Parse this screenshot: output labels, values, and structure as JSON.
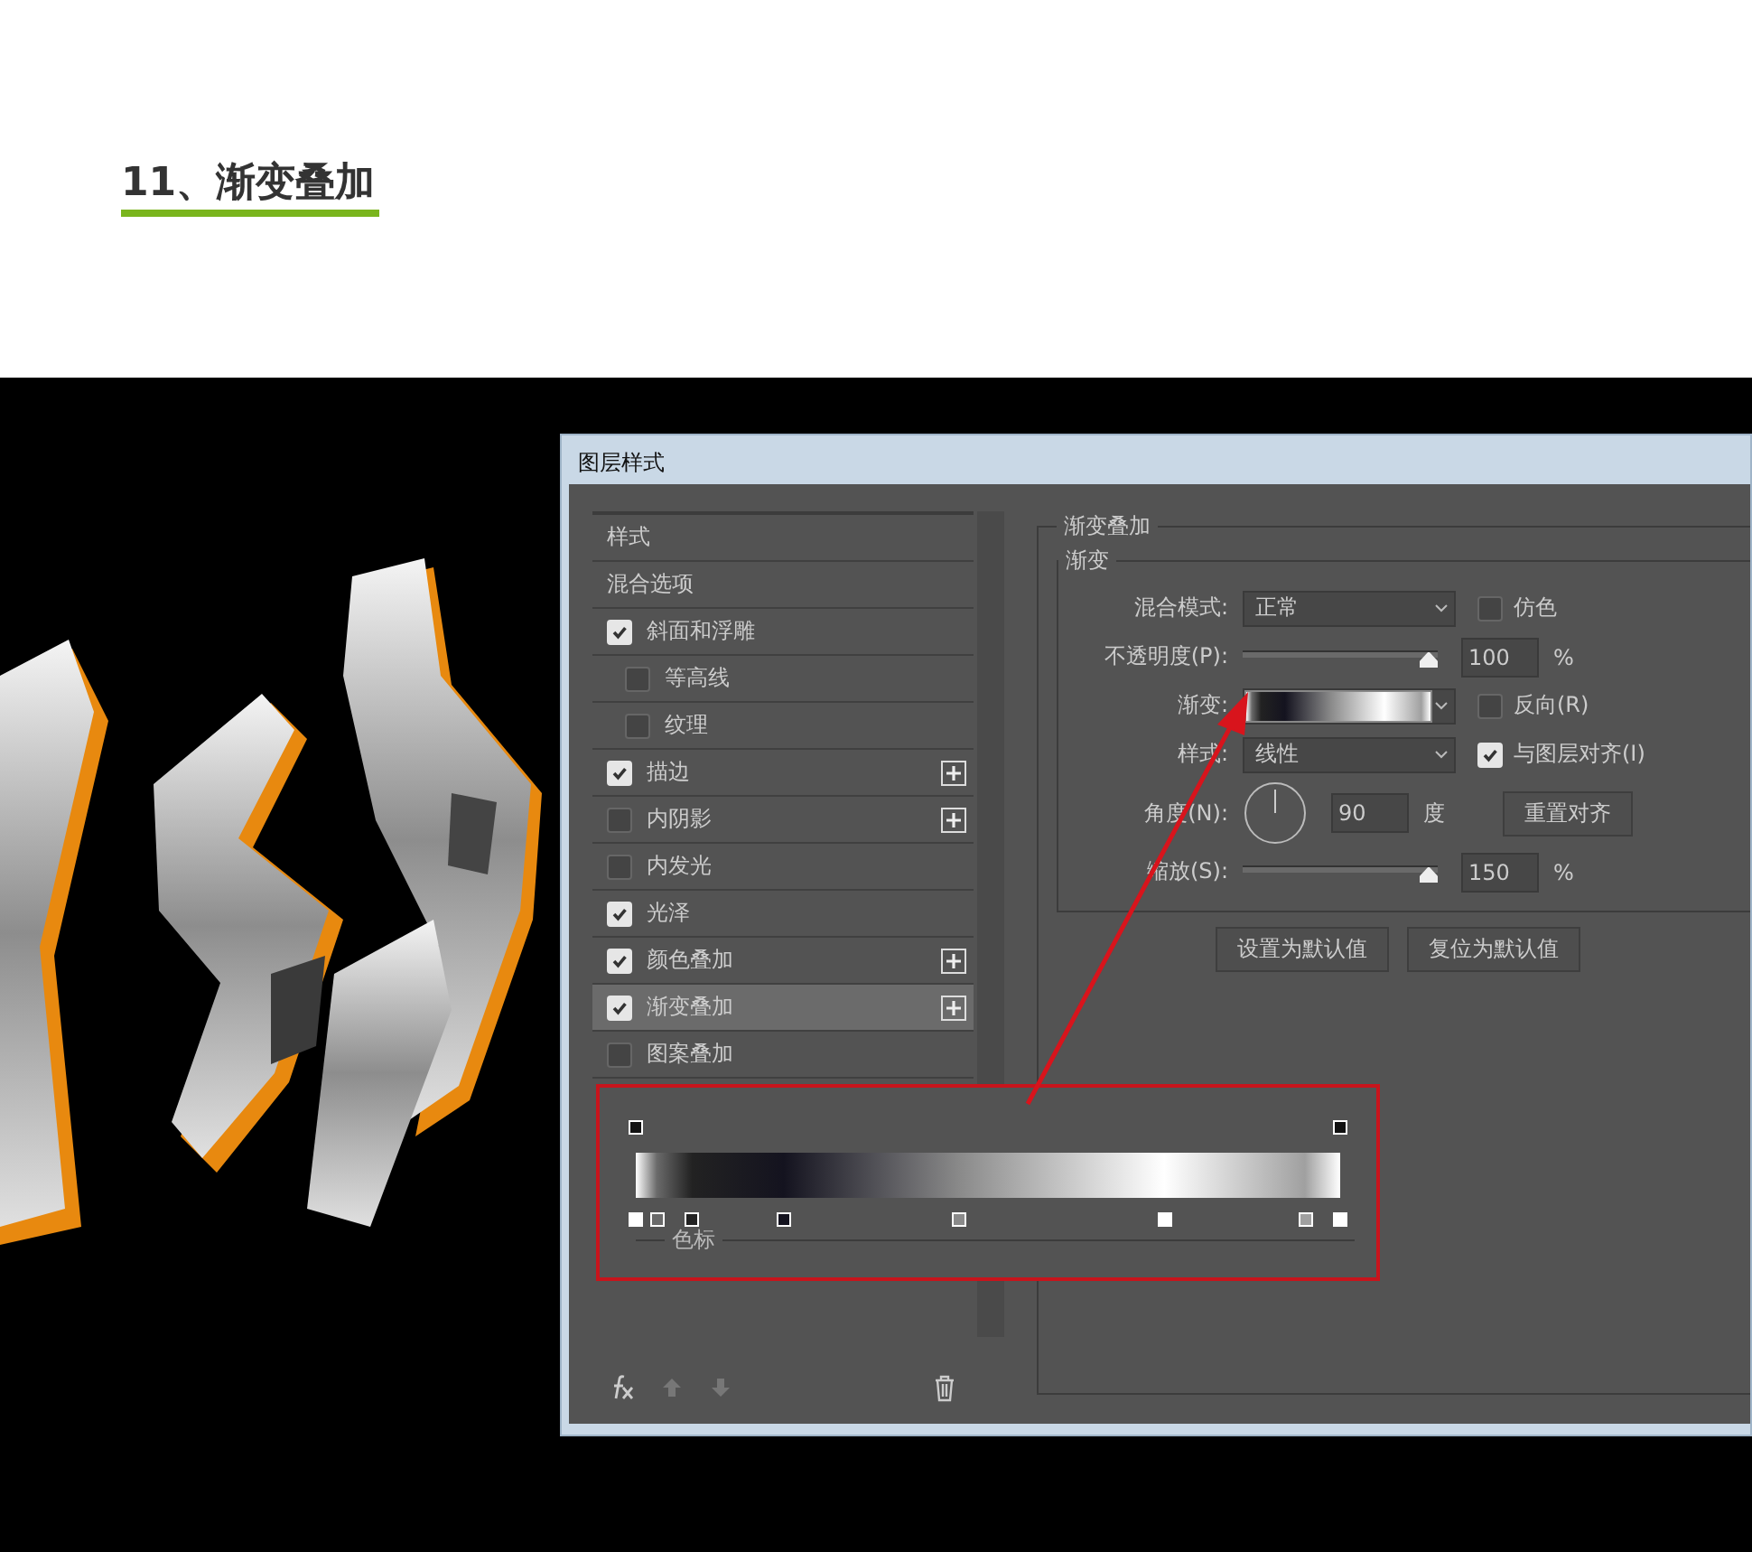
{
  "page_heading": "11、渐变叠加",
  "dialog": {
    "title": "图层样式",
    "layer_styles": [
      {
        "kind": "label",
        "label": "样式",
        "selected": false
      },
      {
        "kind": "label",
        "label": "混合选项",
        "selected": false
      },
      {
        "kind": "option",
        "label": "斜面和浮雕",
        "checked": true,
        "selected": false,
        "children": [
          {
            "kind": "option",
            "label": "等高线",
            "checked": false,
            "selected": false
          },
          {
            "kind": "option",
            "label": "纹理",
            "checked": false,
            "selected": false
          }
        ]
      },
      {
        "kind": "option",
        "label": "描边",
        "checked": true,
        "add_button": true,
        "selected": false
      },
      {
        "kind": "option",
        "label": "内阴影",
        "checked": false,
        "add_button": true,
        "selected": false
      },
      {
        "kind": "option",
        "label": "内发光",
        "checked": false,
        "selected": false
      },
      {
        "kind": "option",
        "label": "光泽",
        "checked": true,
        "selected": false
      },
      {
        "kind": "option",
        "label": "颜色叠加",
        "checked": true,
        "add_button": true,
        "selected": false
      },
      {
        "kind": "option",
        "label": "渐变叠加",
        "checked": true,
        "add_button": true,
        "selected": true
      },
      {
        "kind": "option",
        "label": "图案叠加",
        "checked": false,
        "selected": false
      }
    ],
    "panel": {
      "title": "渐变叠加",
      "group_title": "渐变",
      "blend_mode": {
        "label": "混合模式:",
        "value": "正常"
      },
      "dither": {
        "label": "仿色",
        "checked": false
      },
      "opacity": {
        "label": "不透明度(P):",
        "level": 1,
        "value": "100",
        "unit": "%"
      },
      "gradient": {
        "label": "渐变:"
      },
      "reverse": {
        "label": "反向(R)",
        "checked": false
      },
      "style": {
        "label": "样式:",
        "value": "线性"
      },
      "align": {
        "label": "与图层对齐(I)",
        "checked": true
      },
      "angle": {
        "label": "角度(N):",
        "value": "90",
        "unit": "度"
      },
      "reset_button": "重置对齐",
      "scale": {
        "label": "缩放(S):",
        "level": 1,
        "value": "150",
        "unit": "%"
      },
      "buttons": [
        "设置为默认值",
        "复位为默认值"
      ]
    },
    "gradient_editor": {
      "opacity_stops": [
        {
          "level": 0
        },
        {
          "level": 1
        }
      ],
      "color_stops": [
        {
          "level": 0,
          "color": "#ffffff"
        },
        {
          "level": 0.03,
          "color": "#6a6a6a"
        },
        {
          "level": 0.08,
          "color": "#222222"
        },
        {
          "level": 0.21,
          "color": "#14131f"
        },
        {
          "level": 0.46,
          "color": "#8a8a8a"
        },
        {
          "level": 0.75,
          "color": "#ffffff"
        },
        {
          "level": 0.95,
          "color": "#a0a0a0"
        },
        {
          "level": 1,
          "color": "#ffffff"
        }
      ],
      "section_label": "色标"
    }
  }
}
